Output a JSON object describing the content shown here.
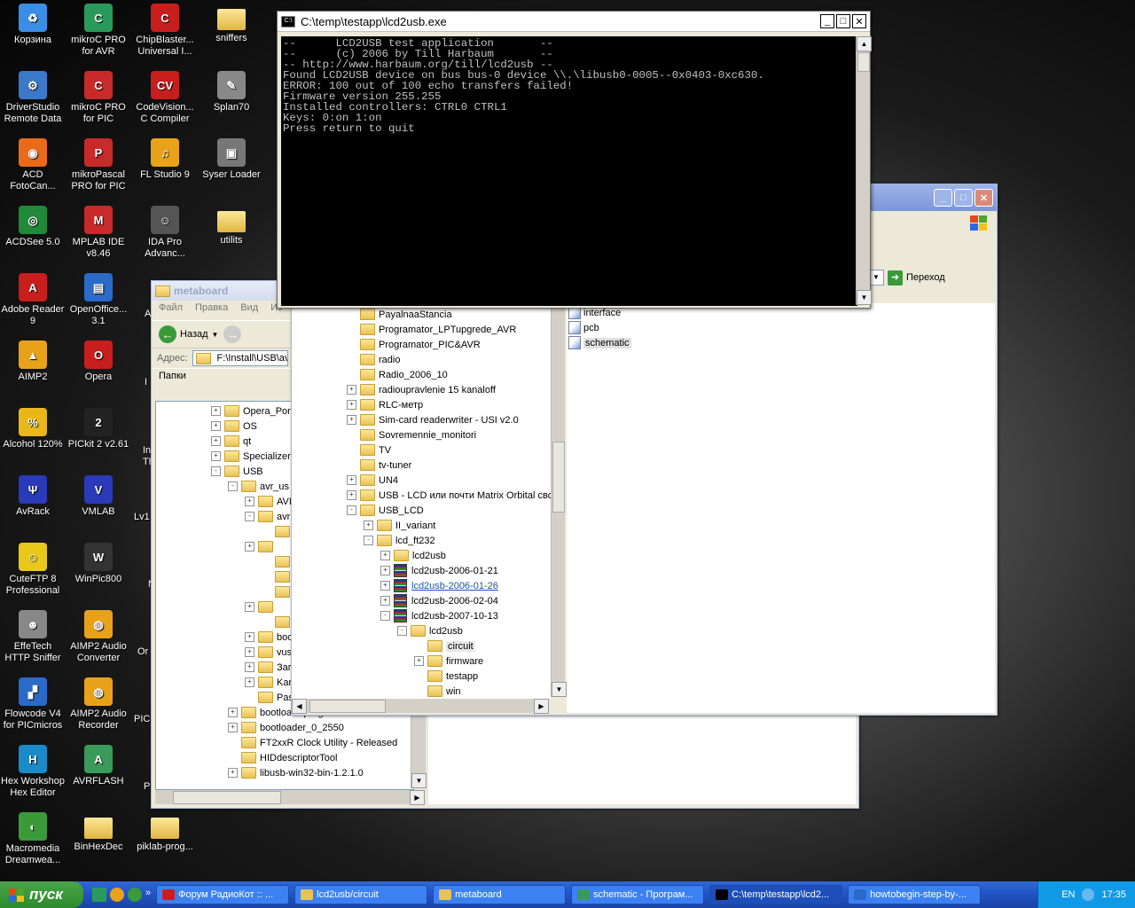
{
  "desktop": {
    "icons": [
      {
        "label": "Корзина",
        "icon": "recycle-bin-icon",
        "color": "#3a8ee6",
        "glyph": "♻"
      },
      {
        "label": "DriverStudio Remote Data",
        "icon": "gear-icon",
        "color": "#3c78c8",
        "glyph": "⚙"
      },
      {
        "label": "ACD FotoCan...",
        "icon": "camera-icon",
        "color": "#e86a1a",
        "glyph": "◉"
      },
      {
        "label": "ACDSee 5.0",
        "icon": "eye-icon",
        "color": "#1e8a3a",
        "glyph": "◎"
      },
      {
        "label": "Adobe Reader 9",
        "icon": "pdf-icon",
        "color": "#c81e1e",
        "glyph": "A"
      },
      {
        "label": "AIMP2",
        "icon": "aimp-icon",
        "color": "#e8a21a",
        "glyph": "▲"
      },
      {
        "label": "Alcohol 120%",
        "icon": "alcohol-icon",
        "color": "#e8b81a",
        "glyph": "%"
      },
      {
        "label": "AvRack",
        "icon": "avrack-icon",
        "color": "#2a3ab8",
        "glyph": "Ψ"
      },
      {
        "label": "CuteFTP 8 Professional",
        "icon": "ftp-icon",
        "color": "#e8c81a",
        "glyph": "☺"
      },
      {
        "label": "EffeTech HTTP Sniffer",
        "icon": "sniffer-icon",
        "color": "#888888",
        "glyph": "☻"
      },
      {
        "label": "Flowcode V4 for PICmicros",
        "icon": "flowcode-icon",
        "color": "#2a6ac8",
        "glyph": "▞"
      },
      {
        "label": "Hex Workshop Hex Editor",
        "icon": "hex-icon",
        "color": "#1a8ac8",
        "glyph": "H"
      },
      {
        "label": "Macromedia Dreamwea...",
        "icon": "dreamweaver-icon",
        "color": "#3a9a3a",
        "glyph": "◐"
      },
      {
        "label": "mikroC PRO for AVR",
        "icon": "mikroc-avr-icon",
        "color": "#2a9a5a",
        "glyph": "C"
      },
      {
        "label": "mikroC PRO for PIC",
        "icon": "mikroc-pic-icon",
        "color": "#c82a2a",
        "glyph": "C"
      },
      {
        "label": "mikroPascal PRO for PIC",
        "icon": "mikropascal-icon",
        "color": "#c82a2a",
        "glyph": "P"
      },
      {
        "label": "MPLAB IDE v8.46",
        "icon": "mplab-icon",
        "color": "#c82a2a",
        "glyph": "M"
      },
      {
        "label": "OpenOffice... 3.1",
        "icon": "openoffice-icon",
        "color": "#2a6ac8",
        "glyph": "▤"
      },
      {
        "label": "Opera",
        "icon": "opera-icon",
        "color": "#c81e1e",
        "glyph": "O"
      },
      {
        "label": "PICkit 2 v2.61",
        "icon": "pickit-icon",
        "color": "#222222",
        "glyph": "2"
      },
      {
        "label": "VMLAB",
        "icon": "vmlab-icon",
        "color": "#2a3ab8",
        "glyph": "V"
      },
      {
        "label": "WinPic800",
        "icon": "winpic-icon",
        "color": "#333333",
        "glyph": "W"
      },
      {
        "label": "AIMP2 Audio Converter",
        "icon": "aimp-converter-icon",
        "color": "#e8a21a",
        "glyph": "◍"
      },
      {
        "label": "AIMP2 Audio Recorder",
        "icon": "aimp-recorder-icon",
        "color": "#e8a21a",
        "glyph": "◍"
      },
      {
        "label": "AVRFLASH",
        "icon": "avrflash-icon",
        "color": "#3a9a5a",
        "glyph": "A"
      },
      {
        "label": "BinHexDec",
        "icon": "folder-icon",
        "color": "#e8c252",
        "glyph": ""
      },
      {
        "label": "ChipBlaster... Universal I...",
        "icon": "chipblaster-icon",
        "color": "#c81e1e",
        "glyph": "C"
      },
      {
        "label": "CodeVision... C Compiler",
        "icon": "codevision-icon",
        "color": "#c81e1e",
        "glyph": "CV"
      },
      {
        "label": "FL Studio 9",
        "icon": "flstudio-icon",
        "color": "#e8a21a",
        "glyph": "♫"
      },
      {
        "label": "IDA Pro Advanc...",
        "icon": "ida-icon",
        "color": "#555555",
        "glyph": "☺"
      },
      {
        "label": "piklab-prog...",
        "icon": "folder-icon",
        "color": "#e8c252",
        "glyph": ""
      },
      {
        "label": "sniffers",
        "icon": "folder-icon",
        "color": "#e8c252",
        "glyph": ""
      },
      {
        "label": "Splan70",
        "icon": "splan-icon",
        "color": "#888888",
        "glyph": "✎"
      },
      {
        "label": "Syser Loader",
        "icon": "syser-icon",
        "color": "#777777",
        "glyph": "▣"
      },
      {
        "label": "utilits",
        "icon": "folder-icon",
        "color": "#e8c252",
        "glyph": ""
      }
    ],
    "partial_labels": [
      "A",
      "I",
      "In",
      "Th",
      "Lv1",
      "N",
      "Or",
      "PIC",
      "P"
    ]
  },
  "console": {
    "title": "C:\\temp\\testapp\\lcd2usb.exe",
    "lines": [
      "--      LCD2USB test application       --",
      "--      (c) 2006 by Till Harbaum       --",
      "-- http://www.harbaum.org/till/lcd2usb --",
      "Found LCD2USB device on bus bus-0 device \\\\.\\libusb0-0005--0x0403-0xc630.",
      "ERROR: 100 out of 100 echo transfers failed!",
      "Firmware version 255.255",
      "Installed controllers: CTRL0 CTRL1",
      "Keys: 0:on 1:on",
      "Press return to quit"
    ]
  },
  "metaboard": {
    "title": "metaboard",
    "menu": [
      "Файл",
      "Правка",
      "Вид",
      "Из"
    ],
    "back_label": "Назад",
    "address_label": "Адрес:",
    "address_value": "F:\\Install\\USB\\avr",
    "folders_label": "Папки",
    "tree": [
      {
        "indent": 0,
        "pm": "+",
        "label": "Opera_Por"
      },
      {
        "indent": 0,
        "pm": "+",
        "label": "OS"
      },
      {
        "indent": 0,
        "pm": "+",
        "label": "qt"
      },
      {
        "indent": 0,
        "pm": "+",
        "label": "SpecializerF"
      },
      {
        "indent": 0,
        "pm": "-",
        "label": "USB"
      },
      {
        "indent": 1,
        "pm": "-",
        "label": "avr_us"
      },
      {
        "indent": 2,
        "pm": "+",
        "label": "AVI"
      },
      {
        "indent": 2,
        "pm": "-",
        "label": "avr"
      },
      {
        "indent": 3,
        "pm": "",
        "label": ""
      },
      {
        "indent": 2,
        "pm": "+",
        "label": ""
      },
      {
        "indent": 3,
        "pm": "",
        "label": ""
      },
      {
        "indent": 3,
        "pm": "",
        "label": ""
      },
      {
        "indent": 3,
        "pm": "",
        "label": ""
      },
      {
        "indent": 2,
        "pm": "+",
        "label": ""
      },
      {
        "indent": 3,
        "pm": "",
        "label": ""
      },
      {
        "indent": 2,
        "pm": "+",
        "label": "boo"
      },
      {
        "indent": 2,
        "pm": "+",
        "label": "vus"
      },
      {
        "indent": 2,
        "pm": "+",
        "label": "Зап"
      },
      {
        "indent": 2,
        "pm": "+",
        "label": "Kar"
      },
      {
        "indent": 2,
        "pm": "",
        "label": "Pas"
      },
      {
        "indent": 1,
        "pm": "+",
        "label": "bootload&programed USB"
      },
      {
        "indent": 1,
        "pm": "+",
        "label": "bootloader_0_2550"
      },
      {
        "indent": 1,
        "pm": "",
        "label": "FT2xxR Clock Utility - Released"
      },
      {
        "indent": 1,
        "pm": "",
        "label": "HIDdescriptorTool"
      },
      {
        "indent": 1,
        "pm": "+",
        "label": "libusb-win32-bin-1.2.1.0"
      }
    ]
  },
  "circuit_window": {
    "go_label": "Переход",
    "tree": [
      {
        "indent": 0,
        "pm": "",
        "kind": "folder",
        "label": "PayalnaaStancia"
      },
      {
        "indent": 0,
        "pm": "",
        "kind": "folder",
        "label": "Programator_LPTupgrede_AVR"
      },
      {
        "indent": 0,
        "pm": "",
        "kind": "folder",
        "label": "Programator_PIC&AVR"
      },
      {
        "indent": 0,
        "pm": "",
        "kind": "folder",
        "label": "radio"
      },
      {
        "indent": 0,
        "pm": "",
        "kind": "folder",
        "label": "Radio_2006_10"
      },
      {
        "indent": 0,
        "pm": "+",
        "kind": "folder",
        "label": "radioupravlenie 15 kanaloff"
      },
      {
        "indent": 0,
        "pm": "+",
        "kind": "folder",
        "label": "RLC-метр"
      },
      {
        "indent": 0,
        "pm": "+",
        "kind": "folder",
        "label": "Sim-card readerwriter - USI v2.0"
      },
      {
        "indent": 0,
        "pm": "",
        "kind": "folder",
        "label": "Sovremennie_monitori"
      },
      {
        "indent": 0,
        "pm": "",
        "kind": "folder",
        "label": "TV"
      },
      {
        "indent": 0,
        "pm": "",
        "kind": "folder",
        "label": "tv-tuner"
      },
      {
        "indent": 0,
        "pm": "+",
        "kind": "folder",
        "label": "UN4"
      },
      {
        "indent": 0,
        "pm": "+",
        "kind": "folder",
        "label": "USB - LCD или почти Matrix Orbital сво"
      },
      {
        "indent": 0,
        "pm": "-",
        "kind": "folder",
        "label": "USB_LCD"
      },
      {
        "indent": 1,
        "pm": "+",
        "kind": "folder",
        "label": "II_variant"
      },
      {
        "indent": 1,
        "pm": "-",
        "kind": "folder",
        "label": "lcd_ft232"
      },
      {
        "indent": 2,
        "pm": "+",
        "kind": "folder",
        "label": "lcd2usb"
      },
      {
        "indent": 2,
        "pm": "+",
        "kind": "zip",
        "label": "lcd2usb-2006-01-21"
      },
      {
        "indent": 2,
        "pm": "+",
        "kind": "zip",
        "label": "lcd2usb-2006-01-26",
        "link": true
      },
      {
        "indent": 2,
        "pm": "+",
        "kind": "zip",
        "label": "lcd2usb-2006-02-04"
      },
      {
        "indent": 2,
        "pm": "-",
        "kind": "zip",
        "label": "lcd2usb-2007-10-13"
      },
      {
        "indent": 3,
        "pm": "-",
        "kind": "folder",
        "label": "lcd2usb"
      },
      {
        "indent": 4,
        "pm": "",
        "kind": "folder",
        "label": "circuit",
        "selected": true
      },
      {
        "indent": 4,
        "pm": "+",
        "kind": "folder",
        "label": "firmware"
      },
      {
        "indent": 4,
        "pm": "",
        "kind": "folder",
        "label": "testapp"
      },
      {
        "indent": 4,
        "pm": "",
        "kind": "folder",
        "label": "win"
      }
    ],
    "files": [
      {
        "label": "interface",
        "icon": "schematic-file-icon"
      },
      {
        "label": "pcb",
        "icon": "schematic-file-icon"
      },
      {
        "label": "schematic",
        "icon": "schematic-file-icon",
        "selected": true
      }
    ]
  },
  "taskbar": {
    "start_label": "пуск",
    "tasks": [
      {
        "label": "Форум РадиоКот :: ...",
        "icon": "opera-icon"
      },
      {
        "label": "lcd2usb/circuit",
        "icon": "folder-icon"
      },
      {
        "label": "metaboard",
        "icon": "folder-icon"
      },
      {
        "label": "schematic - Програм...",
        "icon": "image-icon"
      },
      {
        "label": "C:\\temp\\testapp\\lcd2...",
        "icon": "console-icon",
        "active": true
      },
      {
        "label": "howtobegin-step-by-...",
        "icon": "document-icon"
      }
    ],
    "lang": "EN",
    "clock": "17:35"
  }
}
